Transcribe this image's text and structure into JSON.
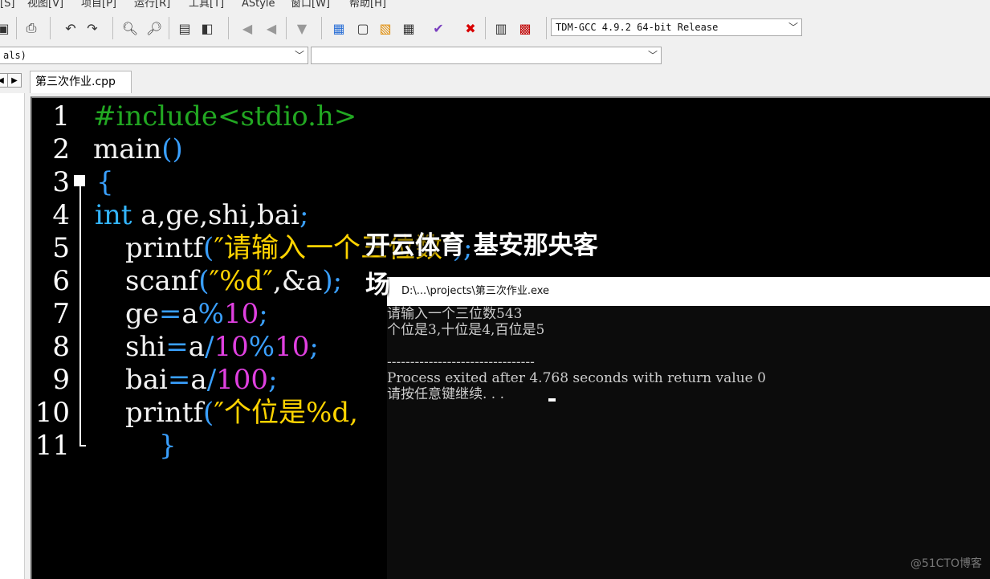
{
  "menu": {
    "items": [
      "[S]",
      "视图[V]",
      "项目[P]",
      "运行[R]",
      "工具[T]",
      "AStyle",
      "窗口[W]",
      "帮助[H]"
    ]
  },
  "toolbar": {
    "compiler": "TDM-GCC 4.9.2 64-bit Release",
    "combo_left": "als)",
    "combo_right": ""
  },
  "tabs": {
    "active": "第三次作业.cpp"
  },
  "editor": {
    "line_numbers": [
      "1",
      "2",
      "3",
      "4",
      "5",
      "6",
      "7",
      "8",
      "9",
      "10",
      "11"
    ]
  },
  "console": {
    "title": "D:\\...\\projects\\第三次作业.exe",
    "lines": [
      "请输入一个三位数543",
      "个位是3,十位是4,百位是5",
      "",
      "--------------------------------",
      "Process exited after 4.768 seconds with return value 0",
      "请按任意键继续. . ."
    ]
  },
  "overlay": {
    "line1": "开云体育 基安那央客",
    "line2": "场"
  },
  "watermark": "@51CTO博客"
}
